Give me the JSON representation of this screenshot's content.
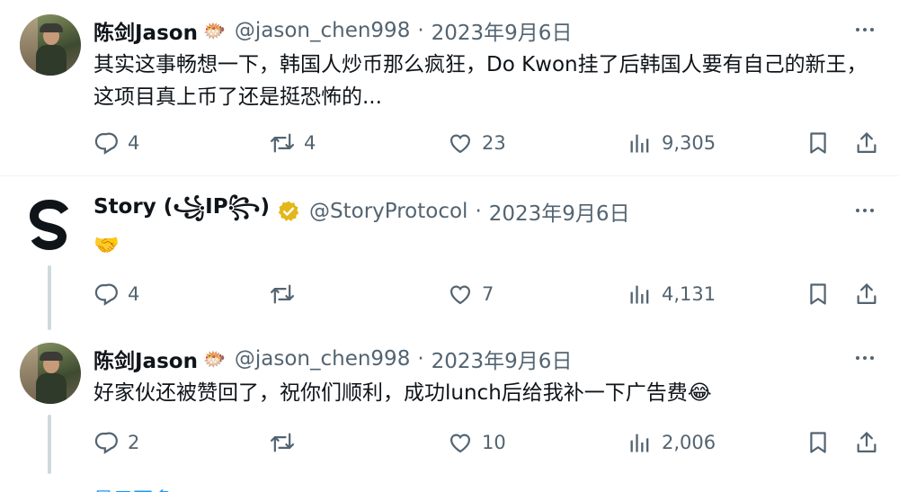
{
  "tweets": [
    {
      "name": "陈剑Jason",
      "name_emoji": "🐡",
      "handle": "@jason_chen998",
      "separator": "·",
      "date": "2023年9月6日",
      "text": "其实这事畅想一下，韩国人炒币那么疯狂，Do Kwon挂了后韩国人要有自己的新王，这项目真上币了还是挺恐怖的...",
      "replies": "4",
      "retweets": "4",
      "likes": "23",
      "views": "9,305"
    },
    {
      "name": "Story (꧁IP꧂)",
      "handle": "@StoryProtocol",
      "separator": "·",
      "date": "2023年9月6日",
      "text": "🤝",
      "replies": "4",
      "retweets": "",
      "likes": "7",
      "views": "4,131"
    },
    {
      "name": "陈剑Jason",
      "name_emoji": "🐡",
      "handle": "@jason_chen998",
      "separator": "·",
      "date": "2023年9月6日",
      "text": "好家伙还被赞回了，祝你们顺利，成功lunch后给我补一下广告费😂",
      "replies": "2",
      "retweets": "",
      "likes": "10",
      "views": "2,006"
    }
  ],
  "show_more": "显示更多",
  "colors": {
    "text": "#0f1419",
    "secondary": "#536471",
    "divider": "#eff3f4",
    "thread_line": "#cfd9de",
    "verified_gold": "#e2b719",
    "link": "#1d9bf0"
  },
  "icons": [
    "reply-icon",
    "retweet-icon",
    "like-icon",
    "views-icon",
    "bookmark-icon",
    "share-icon",
    "more-icon",
    "verified-icon"
  ]
}
